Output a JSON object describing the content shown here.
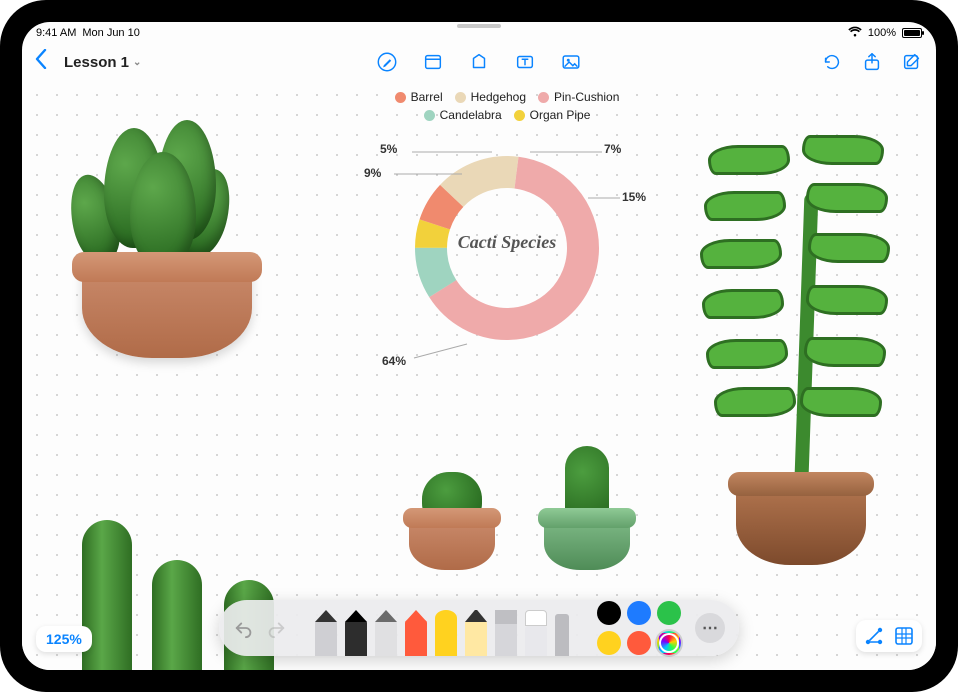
{
  "status": {
    "time": "9:41 AM",
    "date": "Mon Jun 10",
    "battery_pct": "100%"
  },
  "toolbar": {
    "doc_title": "Lesson 1",
    "icons": {
      "back": "chevron-left",
      "pen": "pencil-circle",
      "note": "note",
      "shape": "shape",
      "text": "text-box",
      "media": "photo",
      "undo": "arrow-counterclockwise",
      "share": "square-arrow-up",
      "compose": "square-pencil"
    }
  },
  "chart_data": {
    "type": "pie",
    "title": "Cacti Species",
    "series": [
      {
        "name": "Barrel",
        "value": 7,
        "color": "#f08a6e"
      },
      {
        "name": "Hedgehog",
        "value": 15,
        "color": "#ead8b7"
      },
      {
        "name": "Pin-Cushion",
        "value": 64,
        "color": "#efaaaa"
      },
      {
        "name": "Candelabra",
        "value": 9,
        "color": "#9fd4c0"
      },
      {
        "name": "Organ Pipe",
        "value": 5,
        "color": "#f2d13b"
      }
    ],
    "data_labels": {
      "0": "7%",
      "1": "15%",
      "2": "64%",
      "3": "9%",
      "4": "5%"
    }
  },
  "palette": {
    "colors": [
      "#000000",
      "#1e7bff",
      "#2bc24a",
      "#ffd21f",
      "#ff5a3c"
    ],
    "multicolor_selected": true
  },
  "tools": {
    "items": [
      "text-pen",
      "pen",
      "pencil",
      "crayon",
      "brush",
      "fine-marker",
      "highlighter",
      "eraser",
      "ruler"
    ],
    "undo": "undo",
    "redo": "redo",
    "more": "…"
  },
  "zoom": "125%",
  "view_options": {
    "graph_icon": "graph",
    "grid_icon": "grid"
  }
}
